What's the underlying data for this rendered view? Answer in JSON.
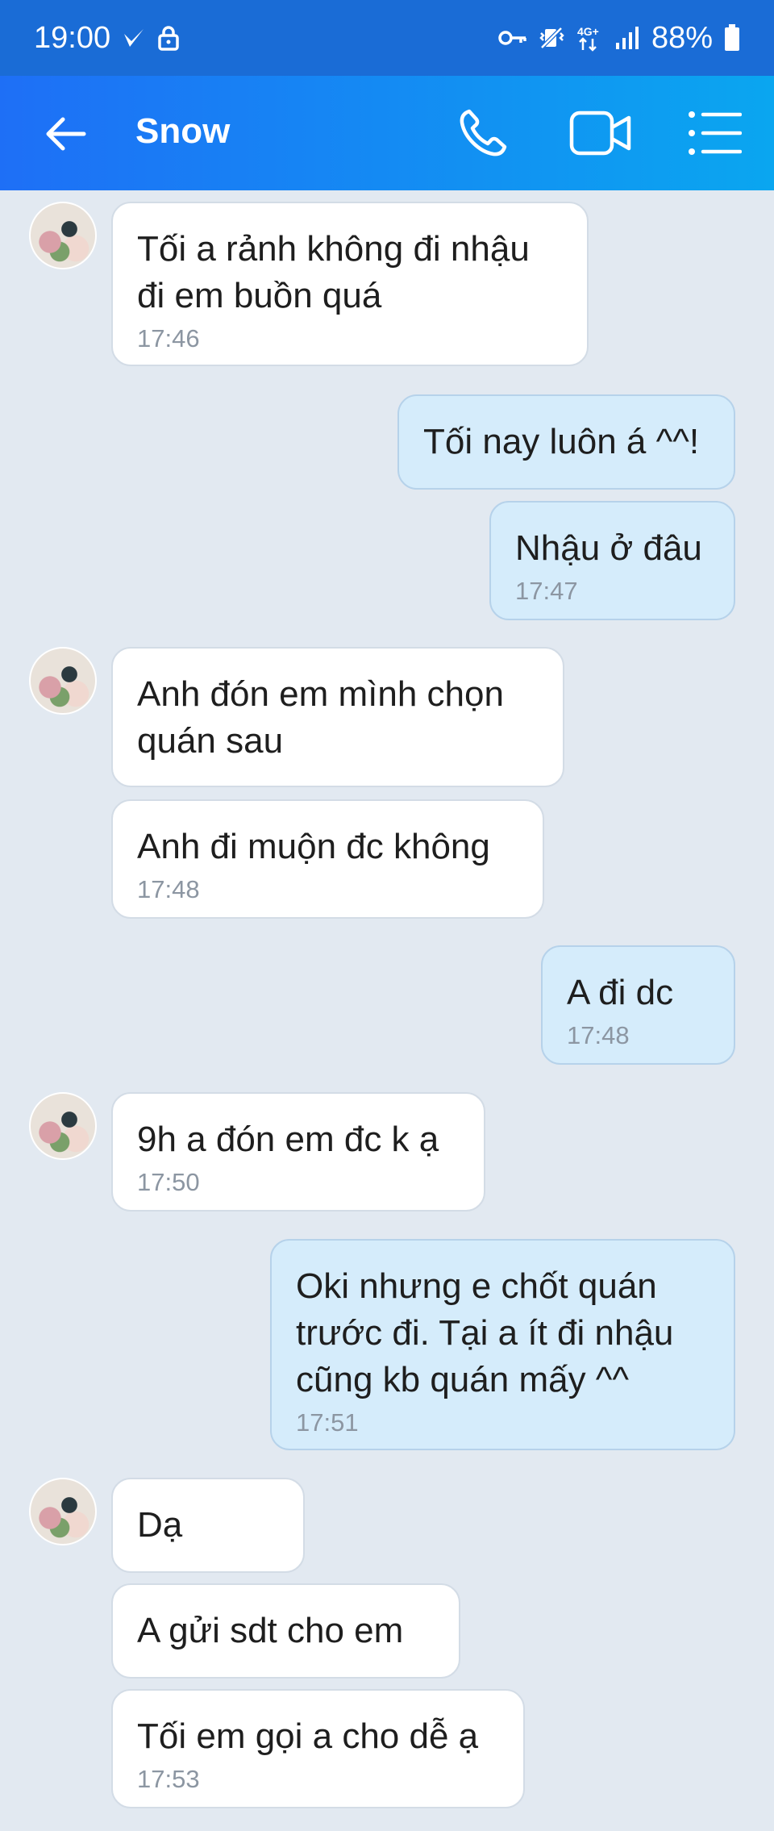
{
  "status_bar": {
    "time": "19:00",
    "battery": "88%",
    "icons": [
      "check-icon",
      "lock-icon",
      "key-icon",
      "vibrate-icon",
      "4g-icon",
      "signal-icon",
      "battery-icon"
    ]
  },
  "header": {
    "title": "Snow",
    "back_icon": "arrow-left-icon",
    "actions": [
      "phone-icon",
      "video-icon",
      "list-menu-icon"
    ],
    "accent": "#1e6ff6"
  },
  "messages": [
    {
      "side": "in",
      "text": "Tối a rảnh không đi nhậu đi em buồn quá",
      "time": "17:46"
    },
    {
      "side": "out",
      "text": "Tối nay luôn á ^^!",
      "time": ""
    },
    {
      "side": "out",
      "text": "Nhậu ở đâu",
      "time": "17:47"
    },
    {
      "side": "in",
      "text": "Anh đón em mình chọn quán sau",
      "time": ""
    },
    {
      "side": "in",
      "text": "Anh đi muộn đc không",
      "time": "17:48"
    },
    {
      "side": "out",
      "text": "A đi dc",
      "time": "17:48"
    },
    {
      "side": "in",
      "text": "9h a đón em đc k ạ",
      "time": "17:50"
    },
    {
      "side": "out",
      "text": "Oki nhưng e chốt quán trước đi. Tại a ít đi nhậu cũng kb quán mấy ^^",
      "time": "17:51"
    },
    {
      "side": "in",
      "text": "Dạ",
      "time": ""
    },
    {
      "side": "in",
      "text": "A gửi sdt cho em",
      "time": ""
    },
    {
      "side": "in",
      "text": "Tối em gọi a cho dễ ạ",
      "time": "17:53"
    }
  ]
}
